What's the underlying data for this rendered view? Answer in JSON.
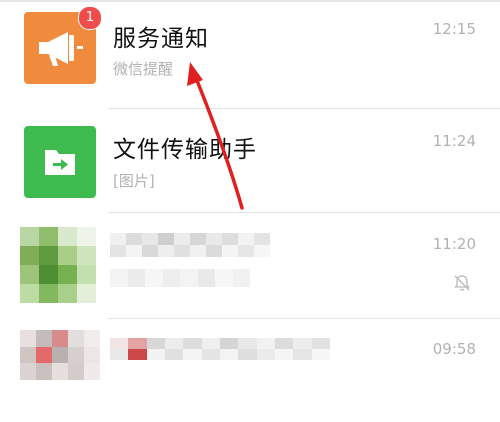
{
  "chats": [
    {
      "name": "服务通知",
      "preview": "微信提醒",
      "time": "12:15",
      "badge": "1",
      "icon": "megaphone-icon",
      "color": "#f08a3c"
    },
    {
      "name": "文件传输助手",
      "preview": "[图片]",
      "time": "11:24",
      "icon": "folder-arrow-icon",
      "color": "#3dbb4f"
    },
    {
      "name": "",
      "preview": "",
      "time": "11:20",
      "icon": "mute-bell-icon"
    },
    {
      "name": "",
      "preview": "",
      "time": "09:58"
    }
  ],
  "annotation": {
    "color": "#e02020"
  }
}
